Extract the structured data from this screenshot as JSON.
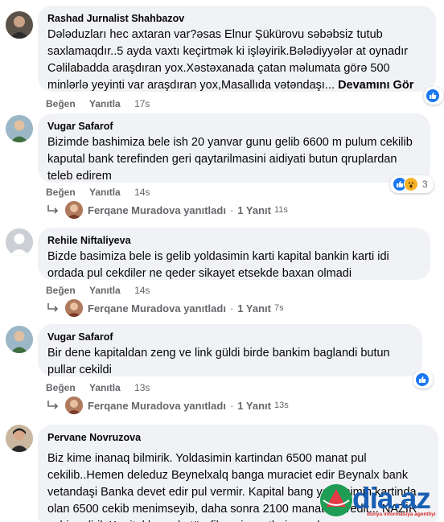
{
  "comments": [
    {
      "author": "Rashad Jurnalist Shahbazov",
      "text": "Dələduzları hec axtaran var?əsas Elnur Şükürovu səbəbsiz tutub saxlamaqdır..5 ayda vaxtı keçirtmək ki işləyirik.Bələdiyyələr at oynadır Cəlilabadda araşdıran yox.Xəstəxanada çatan məlumata görə 500 minlərlə yeyinti var araşdıran yox,Masallıda vətəndaşı...",
      "see_more": "Devamını Gör",
      "like_label": "Beğen",
      "reply_label": "Yanıtla",
      "time": "17s",
      "reaction_count": ""
    },
    {
      "author": "Vugar Safarof",
      "text": "Bizimde bashimiza bele ish 20 yanvar gunu gelib 6600 m pulum cekilib kaputal bank terefinden geri qaytarilmasini aidiyati butun qruplardan teleb edirem",
      "like_label": "Beğen",
      "reply_label": "Yanıtla",
      "time": "14s",
      "reaction_count": "3",
      "reply": {
        "name": "Ferqane Muradova yanıtladı",
        "sep": "·",
        "count": "1 Yanıt",
        "time": "11s"
      }
    },
    {
      "author": "Rehile Niftaliyeva",
      "text": "Bizde basimiza bele is gelib yoldasimin karti kapital bankin karti idi ordada pul cekdiler ne qeder sikayet etsekde baxan olmadi",
      "like_label": "Beğen",
      "reply_label": "Yanıtla",
      "time": "14s",
      "reply": {
        "name": "Ferqane Muradova yanıtladı",
        "sep": "·",
        "count": "1 Yanıt",
        "time": "7s"
      }
    },
    {
      "author": "Vugar Safarof",
      "text": "Bir dene kapitaldan zeng ve link güldi birde bankim baglandi butun pullar cekildi",
      "like_label": "Beğen",
      "reply_label": "Yanıtla",
      "time": "13s",
      "reply": {
        "name": "Ferqane Muradova yanıtladı",
        "sep": "·",
        "count": "1 Yanıt",
        "time": "13s"
      }
    },
    {
      "author": "Pervane Novruzova",
      "text": "Biz kime inanaq bilmirik. Yoldasimin kartindan 6500 manat pul cekilib..Hemen deleduz Beynelxalq banga muraciet edir Beynalx bank vetandaşi Banka devet edir pul vermir. Kapital bang yoldasimin kartinda olan 6500 cekib menimseyib, daha sonra 2100 manatda kredit... NAZİR xahis edirik Kapital bangda törefilen cinayetleri araşdırasız"
    }
  ],
  "watermark": {
    "brand": "dia.az",
    "tagline": "dünya informasiya agentliyi"
  },
  "colors": {
    "like_blue": "#1877f2",
    "wow_yellow": "#f7b125",
    "bubble_gray": "#f0f2f5",
    "meta_gray": "#65676b"
  },
  "icons": {
    "like": "thumbs-up-icon",
    "wow": "wow-face-icon",
    "reply": "reply-arrow-icon"
  }
}
